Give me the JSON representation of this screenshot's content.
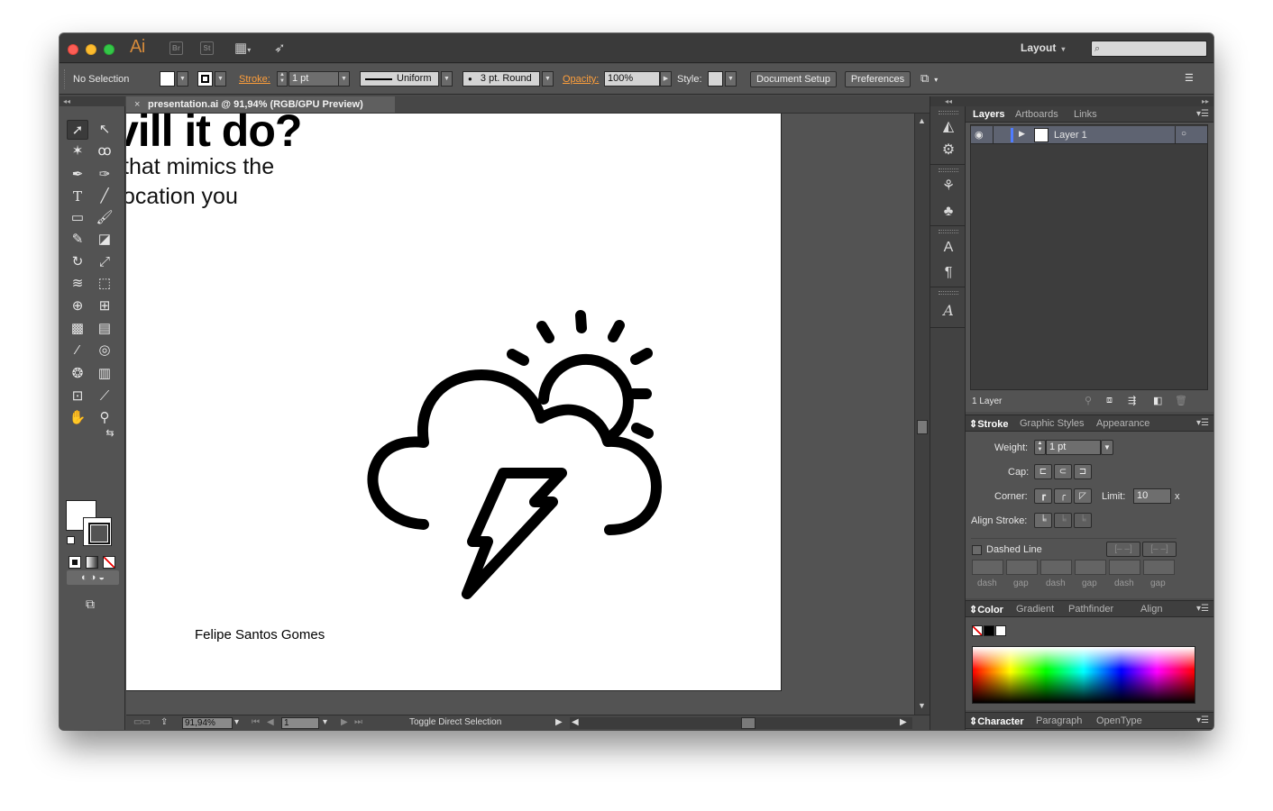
{
  "app": {
    "logo": "Ai",
    "bridge_label": "Br",
    "stock_label": "St",
    "workspace": "Layout",
    "search_placeholder": ""
  },
  "control_bar": {
    "selection_status": "No Selection",
    "stroke_label": "Stroke:",
    "stroke_weight": "1 pt",
    "profile": "Uniform",
    "brush": "3 pt. Round",
    "opacity_label": "Opacity:",
    "opacity_value": "100%",
    "style_label": "Style:",
    "document_setup": "Document Setup",
    "preferences": "Preferences"
  },
  "document": {
    "tab_title": "presentation.ai @ 91,94% (RGB/GPU Preview)",
    "headline": "vill it do?",
    "body_lines": [
      "that mimics the",
      "ocation you"
    ],
    "author": "Felipe Santos Gomes"
  },
  "status_bar": {
    "zoom": "91,94%",
    "artboard_number": "1",
    "status_text": "Toggle Direct Selection"
  },
  "layers_panel": {
    "tabs": [
      "Layers",
      "Artboards",
      "Links"
    ],
    "layers": [
      {
        "name": "Layer 1"
      }
    ],
    "footer_count": "1 Layer"
  },
  "stroke_panel": {
    "tabs": [
      "Stroke",
      "Graphic Styles",
      "Appearance"
    ],
    "weight_label": "Weight:",
    "weight_value": "1 pt",
    "cap_label": "Cap:",
    "corner_label": "Corner:",
    "limit_label": "Limit:",
    "limit_value": "10",
    "limit_unit": "x",
    "align_stroke_label": "Align Stroke:",
    "dashed_line_label": "Dashed Line",
    "dash_labels": [
      "dash",
      "gap",
      "dash",
      "gap",
      "dash",
      "gap"
    ]
  },
  "color_panel": {
    "tabs": [
      "Color",
      "Gradient",
      "Pathfinder",
      "Align"
    ]
  },
  "character_panel": {
    "tabs": [
      "Character",
      "Paragraph",
      "OpenType"
    ]
  },
  "colors": {
    "accent_orange": "#ff9f3b",
    "selected_layer_row": "#5e6371",
    "layer_color_bar": "#4f7cff"
  }
}
